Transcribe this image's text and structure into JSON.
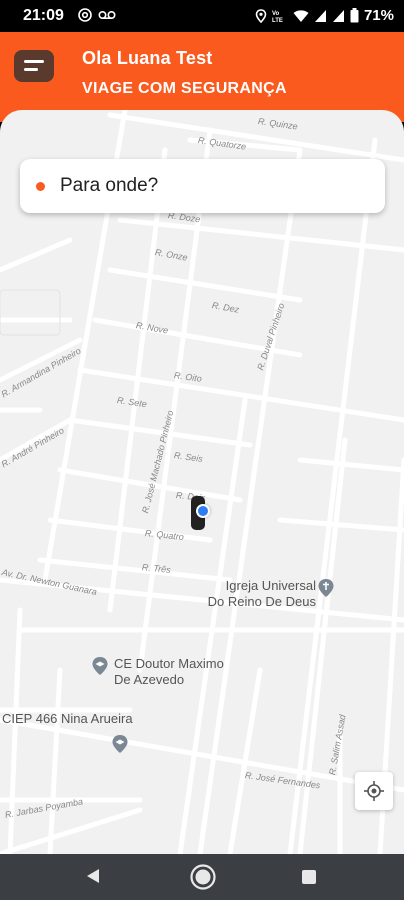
{
  "status": {
    "time": "21:09",
    "battery": "71%",
    "icons": [
      "at-icon",
      "voicemail-icon",
      "location-icon",
      "volte-icon",
      "wifi-icon",
      "signal-icon",
      "signal-icon",
      "battery-icon"
    ]
  },
  "header": {
    "greeting": "Ola Luana Test",
    "subtitle": "VIAGE COM SEGURANÇA",
    "color": "#fb5a1f"
  },
  "search": {
    "placeholder": "Para onde?"
  },
  "map": {
    "streets": {
      "quinze": "R. Quinze",
      "quatorze": "R. Quatorze",
      "doze": "R. Doze",
      "onze": "R. Onze",
      "dez": "R. Dez",
      "nove": "R. Nove",
      "oito": "R. Oito",
      "sete": "R. Sete",
      "seis": "R. Seis",
      "dois": "R. Dois",
      "quatro": "R. Quatro",
      "tres": "R. Três",
      "duval": "R. Duval Pinheiro",
      "jose_machado": "R. José Machado Pinheiro",
      "armandina": "R. Armandina Pinheiro",
      "andre": "R. André Pinheiro",
      "newton": "Av. Dr. Newton Guanara",
      "jose_fernandes": "R. José Fernandes",
      "salim": "R. Salim Assad",
      "jarbas": "R. Jarbas Poyamba"
    },
    "pois": {
      "igreja": "Igreja Universal\nDo Reino De Deus",
      "ce_line1": "CE Doutor Maximo",
      "ce_line2": "De Azevedo",
      "ciep": "CIEP 466 Nina Arueira"
    }
  },
  "nav": {
    "back": "back-icon",
    "home": "home-icon",
    "recent": "recent-apps-icon"
  }
}
